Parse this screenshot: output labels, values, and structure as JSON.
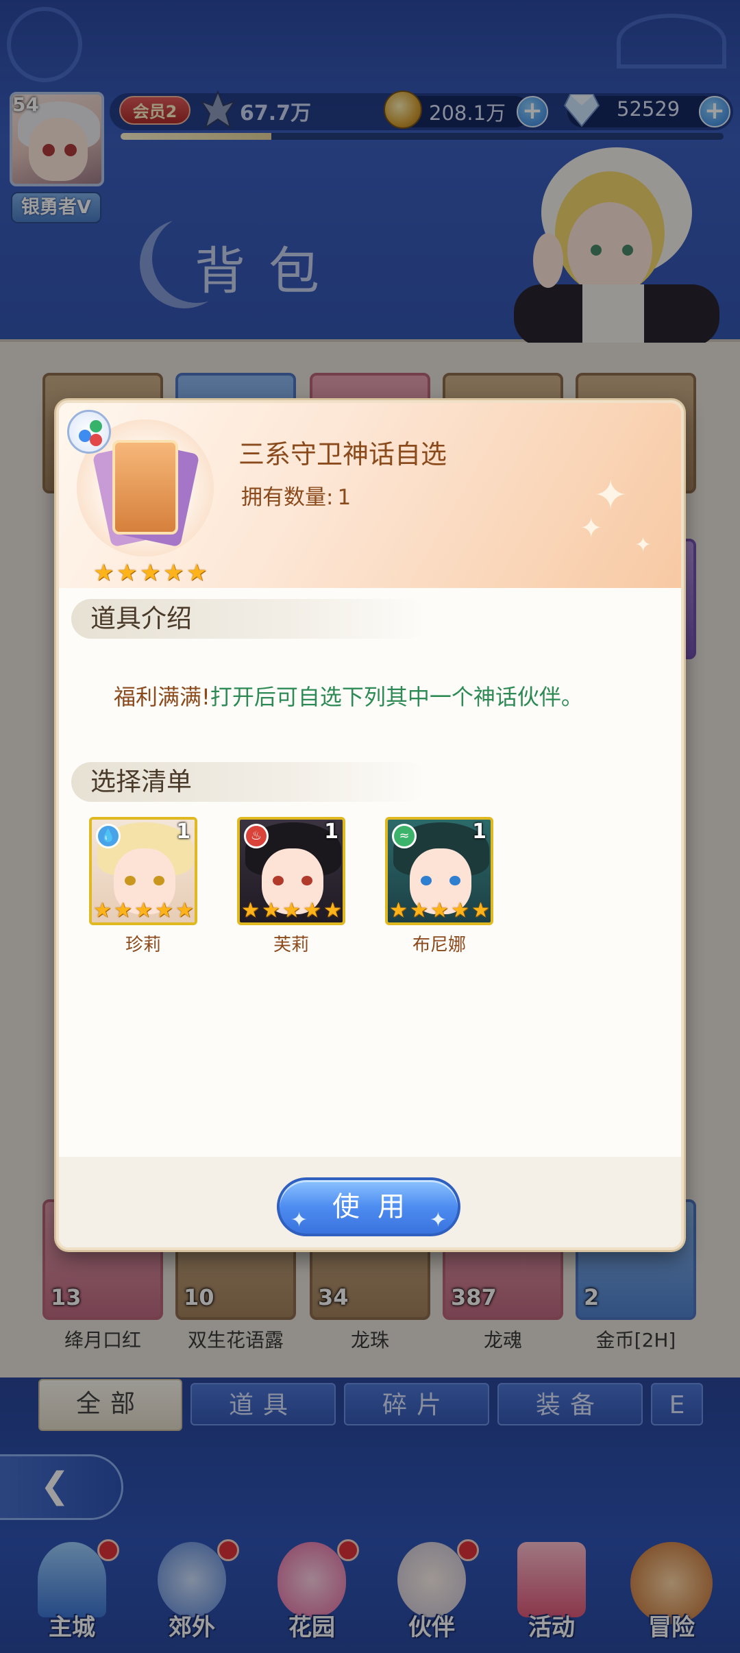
{
  "player": {
    "level": "54",
    "name": "银勇者V",
    "vip": "会员2",
    "power": "67.7万",
    "gold": "208.1万",
    "gems": "52529",
    "exp_fraction": 0.25
  },
  "page_title": "背包",
  "inventory_bottom_row": [
    {
      "qty": "13",
      "label": "绛月口红"
    },
    {
      "qty": "10",
      "label": "双生花语露"
    },
    {
      "qty": "34",
      "label": "龙珠"
    },
    {
      "qty": "387",
      "label": "龙魂"
    },
    {
      "qty": "2",
      "label": "金币[2H]"
    }
  ],
  "tabs": [
    "全部",
    "道具",
    "碎片",
    "装备",
    "E"
  ],
  "modal": {
    "item_name": "三系守卫神话自选",
    "count_label": "拥有数量:",
    "count_value": "1",
    "stars": 5,
    "section_intro": "道具介绍",
    "desc_lead": "福利满满!",
    "desc_body": "打开后可自选下列其中一个神话伙伴。",
    "section_choices": "选择清单",
    "choices": [
      {
        "name": "珍莉",
        "qty": "1",
        "element": "water"
      },
      {
        "name": "芙莉",
        "qty": "1",
        "element": "fire"
      },
      {
        "name": "布尼娜",
        "qty": "1",
        "element": "wind"
      }
    ],
    "use_button": "使用"
  },
  "nav": [
    {
      "label": "主城",
      "badge": true
    },
    {
      "label": "郊外",
      "badge": true
    },
    {
      "label": "花园",
      "badge": true
    },
    {
      "label": "伙伴",
      "badge": true
    },
    {
      "label": "活动",
      "badge": false
    },
    {
      "label": "冒险",
      "badge": false
    }
  ],
  "colors": {
    "header_blue": "#3a5fc0",
    "accent_orange": "#f7c9a3",
    "desc_green": "#2d8a55",
    "text_brown": "#8a4a1c",
    "use_button_blue": "#4d8cf0",
    "badge_red": "#e3323a"
  }
}
